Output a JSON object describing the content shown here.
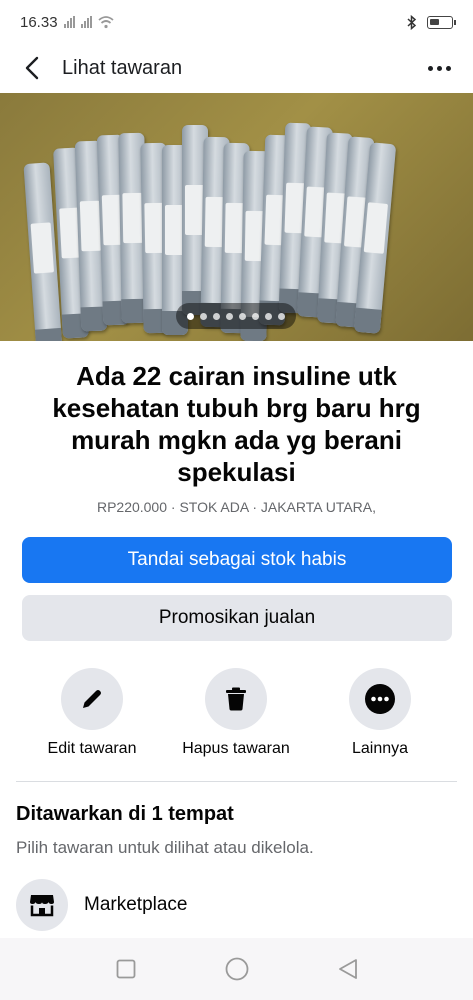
{
  "status_bar": {
    "time": "16.33",
    "sim1": "×",
    "sim2": "×"
  },
  "app_bar": {
    "title": "Lihat tawaran",
    "back_icon": "chevron-left-icon",
    "more_icon": "more-horizontal-icon"
  },
  "photo": {
    "subject": "insulin-pen-photo",
    "carousel_total": 8,
    "carousel_active": 1
  },
  "listing": {
    "title": "Ada 22 cairan insuline utk kesehatan tubuh brg baru hrg murah mgkn ada yg berani spekulasi",
    "meta": "RP220.000 · STOK ADA · JAKARTA UTARA,"
  },
  "buttons": {
    "mark_sold_out": "Tandai sebagai stok habis",
    "promote": "Promosikan jualan"
  },
  "actions": [
    {
      "label": "Edit tawaran",
      "icon": "pencil-icon"
    },
    {
      "label": "Hapus tawaran",
      "icon": "trash-icon"
    },
    {
      "label": "Lainnya",
      "icon": "more-circle-icon"
    }
  ],
  "offered": {
    "title": "Ditawarkan di 1 tempat",
    "subtitle": "Pilih tawaran untuk dilihat atau dikelola.",
    "places": [
      {
        "label": "Marketplace",
        "icon": "storefront-icon"
      }
    ]
  },
  "colors": {
    "primary": "#1877f2",
    "secondary_bg": "#e4e6eb",
    "muted_text": "#65676b"
  }
}
